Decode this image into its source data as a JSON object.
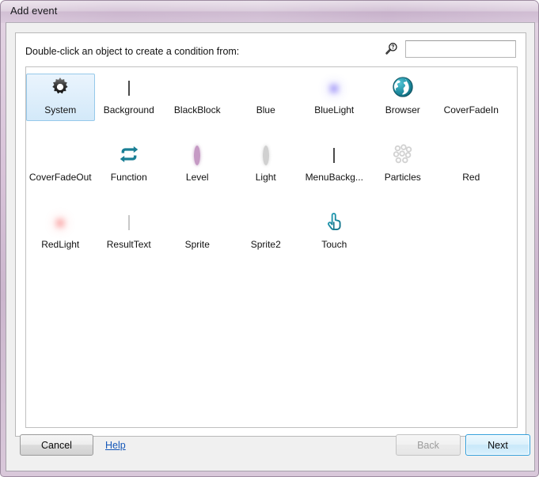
{
  "window": {
    "title": "Add event"
  },
  "content": {
    "instruction": "Double-click an object to create a condition from:"
  },
  "search": {
    "icon": "search-help-icon",
    "value": "",
    "placeholder": ""
  },
  "object_list": {
    "columns": 7,
    "rows": [
      [
        {
          "label": "System",
          "icon": "gear-icon",
          "selected": true
        },
        {
          "label": "Background",
          "icon": "noise-texture-icon",
          "selected": false
        },
        {
          "label": "BlackBlock",
          "icon": "black-square-icon",
          "selected": false
        },
        {
          "label": "Blue",
          "icon": "blue-circle-icon",
          "selected": false
        },
        {
          "label": "BlueLight",
          "icon": "blue-glow-icon",
          "selected": false
        },
        {
          "label": "Browser",
          "icon": "globe-icon",
          "selected": false
        },
        {
          "label": "CoverFadeIn",
          "icon": "black-square-icon",
          "selected": false
        }
      ],
      [
        {
          "label": "CoverFadeOut",
          "icon": "black-square-icon",
          "selected": false
        },
        {
          "label": "Function",
          "icon": "loop-arrows-icon",
          "selected": false
        },
        {
          "label": "Level",
          "icon": "purple-ring-icon",
          "selected": false
        },
        {
          "label": "Light",
          "icon": "gray-ring-icon",
          "selected": false
        },
        {
          "label": "MenuBackg...",
          "icon": "noise-texture-icon",
          "selected": false
        },
        {
          "label": "Particles",
          "icon": "particles-icon",
          "selected": false
        },
        {
          "label": "Red",
          "icon": "red-circle-icon",
          "selected": false
        }
      ],
      [
        {
          "label": "RedLight",
          "icon": "red-glow-icon",
          "selected": false
        },
        {
          "label": "ResultText",
          "icon": "text-document-icon",
          "selected": false
        },
        {
          "label": "Sprite",
          "icon": "blank-icon",
          "selected": false
        },
        {
          "label": "Sprite2",
          "icon": "blank-icon",
          "selected": false
        },
        {
          "label": "Touch",
          "icon": "pointing-hand-icon",
          "selected": false
        },
        {
          "label": "",
          "icon": "blank-icon",
          "selected": false,
          "empty": true
        },
        {
          "label": "",
          "icon": "blank-icon",
          "selected": false,
          "empty": true
        }
      ]
    ]
  },
  "buttons": {
    "cancel": "Cancel",
    "help": "Help",
    "back": "Back",
    "next": "Next",
    "back_disabled": true,
    "next_default": true
  },
  "colors": {
    "titlebar_mauve": "#d4c3d6",
    "selection_blue": "#96c9ea",
    "default_button_border": "#2c9ddb",
    "link_blue": "#1457b8",
    "teal_icon": "#1d8a9e",
    "blue_object": "#1305f0",
    "red_object": "#f50f0f"
  }
}
